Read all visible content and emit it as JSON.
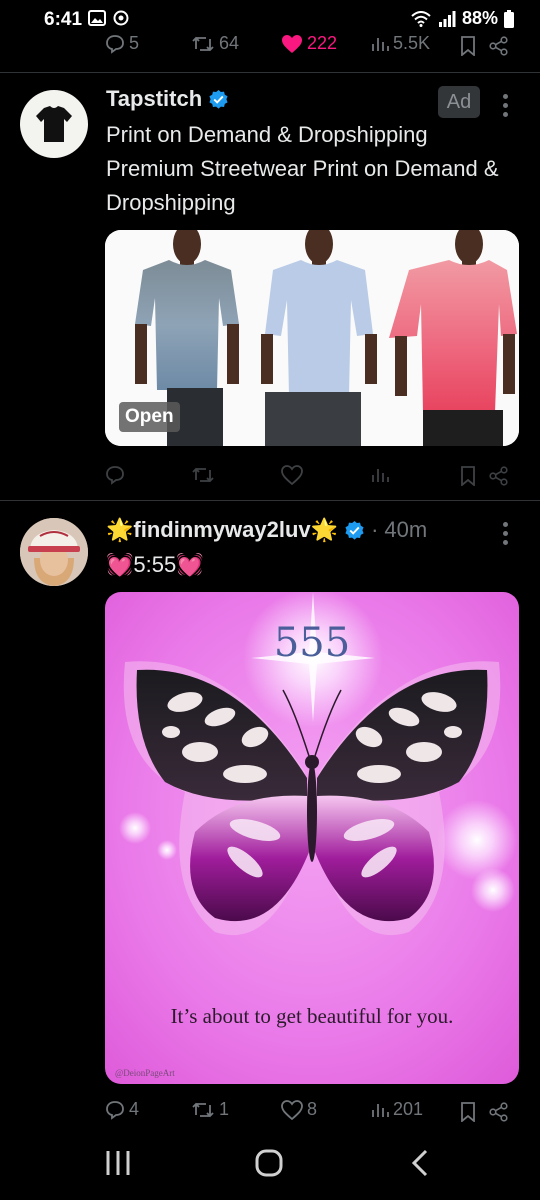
{
  "status_bar": {
    "time": "6:41",
    "battery": "88%",
    "icons": [
      "gallery-icon",
      "data-saver-icon",
      "wifi-icon",
      "signal-icon",
      "battery-icon"
    ]
  },
  "prev_post_actions": {
    "replies": "5",
    "reposts": "64",
    "likes": "222",
    "views": "5.5K"
  },
  "ad_post": {
    "display_name": "Tapstitch",
    "verified": true,
    "ad_label": "Ad",
    "text": "Print on Demand & Dropshipping Premium Streetwear Print on Demand & Dropshipping",
    "open_label": "Open",
    "shirt_colors": [
      "#7f93a6",
      "#b9cbe6",
      "#ee6a80"
    ]
  },
  "post": {
    "display_name": "🌟findinmyway2luv🌟",
    "time": "40m",
    "text": "💓5:55💓",
    "image_number": "555",
    "image_caption": "It’s about to get beautiful for you.",
    "image_credit": "@DeionPageArt",
    "replies": "4",
    "reposts": "1",
    "likes": "8",
    "views": "201"
  },
  "colors": {
    "accent_like": "#f91880",
    "verified_blue": "#1d9bf0",
    "muted": "#71767b"
  }
}
